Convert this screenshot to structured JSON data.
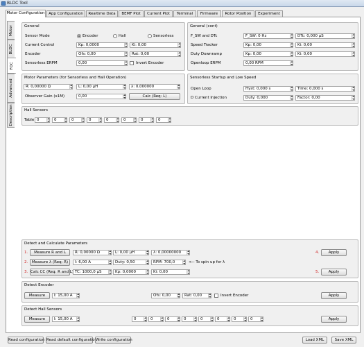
{
  "window": {
    "title": "BLDC Tool"
  },
  "tabs": [
    "Motor Configuration",
    "App Configuration",
    "Realtime Data",
    "BEMF Plot",
    "Current Plot",
    "Terminal",
    "Firmware",
    "Rotor Position",
    "Experiment"
  ],
  "side_tabs": [
    "Motor",
    "BLDC",
    "FOC",
    "Advanced",
    "Description"
  ],
  "general": {
    "title": "General",
    "sensor_mode_label": "Sensor Mode",
    "radio_encoder": "Encoder",
    "radio_hall": "Hall",
    "radio_sensorless": "Sensorless",
    "current_control_label": "Current Control",
    "kp": "Kp: 0,0000",
    "ki": "Ki: 0,00",
    "encoder_label": "Encoder",
    "ofs": "Ofs: 0,00",
    "rat": "Rat: 0,00",
    "sensorless_erpm_label": "Sensorless ERPM",
    "sensorless_erpm": "0,00",
    "invert_encoder": "Invert Encoder"
  },
  "general_cont": {
    "title": "General (cont)",
    "fsw_label": "F_SW and DTc",
    "fsw": "F_SW: 0 Hz",
    "dtc": "DTc: 0,000 µS",
    "speed_tracker_label": "Speed Tracker",
    "speed_kp": "Kp: 0,00",
    "speed_ki": "Ki: 0,00",
    "duty_downramp_label": "Duty Downramp",
    "duty_kp": "Kp: 0,00",
    "duty_ki": "Ki: 0,00",
    "openloop_erpm_label": "Openloop ERPM",
    "openloop_erpm": "0,00 RPM"
  },
  "motor_params": {
    "title": "Motor Parameters (for Sensorless and Hall Operation)",
    "r": "R: 0,00000 Ω",
    "l": "L: 0,00 µH",
    "lambda": "λ: 0,000000",
    "observer_gain_label": "Observer Gain (x1M)",
    "observer_gain": "0,00",
    "calc_button": "Calc (Req: L)"
  },
  "sensorless_startup": {
    "title": "Sensorless Startup and Low Speed",
    "open_loop_label": "Open Loop",
    "hyst": "Hyst: 0,000 s",
    "time": "Time: 0,000 s",
    "d_current_label": "D Current Injection",
    "duty": "Duty: 0,000",
    "factor": "Factor: 0,00"
  },
  "hall_sensors": {
    "title": "Hall Sensors",
    "table_label": "Table",
    "values": [
      "0",
      "0",
      "0",
      "0",
      "0",
      "0",
      "0",
      "0"
    ]
  },
  "detect_calc": {
    "title": "Detect and Calculate Parameters",
    "n1": "1.",
    "n2": "2.",
    "n3": "3.",
    "n4": "4.",
    "n5": "5.",
    "measure_rl": "Measure R and L",
    "r": "R: 0,00000 Ω",
    "l": "L: 0,00 µH",
    "lambda": "λ: 0,00000000",
    "apply1": "Apply",
    "measure_lambda": "Measure λ (Req: R)",
    "i": "I: 6,00 A",
    "duty": "Duty: 0,50",
    "rpm": "RPM: 700,0",
    "note": "<-- To spin up for λ",
    "calc_cc": "Calc CC (Req: R and L)",
    "tc": "TC: 1000,0 µS",
    "kp": "Kp: 0,0000",
    "ki": "Ki: 0,00",
    "apply2": "Apply"
  },
  "detect_encoder": {
    "title": "Detect Encoder",
    "measure": "Measure",
    "i": "I: 15,00 A",
    "ofs": "Ofs: 0,00",
    "rat": "Rat: 0,00",
    "invert": "Invert Encoder",
    "apply": "Apply"
  },
  "detect_hall": {
    "title": "Detect Hall Sensors",
    "measure": "Measure",
    "i": "I: 15,00 A",
    "values": [
      "0",
      "0",
      "0",
      "0",
      "0",
      "0",
      "0",
      "0"
    ],
    "apply": "Apply"
  },
  "bottom": {
    "read_config": "Read configuration",
    "read_default": "Read default configuration",
    "write_config": "Write configuration",
    "load_xml": "Load XML",
    "save_xml": "Save XML"
  },
  "colors": {
    "step_number": "#d02020",
    "pane": "#ffffff",
    "group_bg": "#f0f0f0"
  }
}
